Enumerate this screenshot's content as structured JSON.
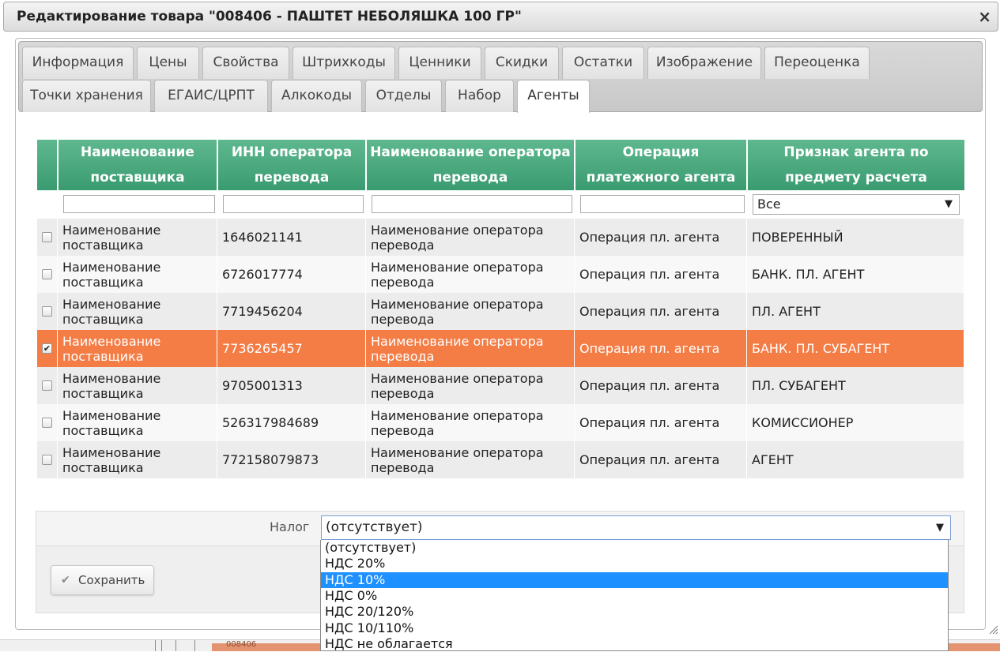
{
  "dialog": {
    "title": "Редактирование товара \"008406 - ПАШТЕТ НЕБОЛЯШКА 100 ГР\"",
    "close_label": "×"
  },
  "tabs": [
    {
      "label": "Информация"
    },
    {
      "label": "Цены"
    },
    {
      "label": "Свойства"
    },
    {
      "label": "Штрихкоды"
    },
    {
      "label": "Ценники"
    },
    {
      "label": "Скидки"
    },
    {
      "label": "Остатки"
    },
    {
      "label": "Изображение"
    },
    {
      "label": "Переоценка"
    },
    {
      "label": "Точки хранения"
    },
    {
      "label": "ЕГАИС/ЦРПТ"
    },
    {
      "label": "Алкокоды"
    },
    {
      "label": "Отделы"
    },
    {
      "label": "Набор"
    },
    {
      "label": "Агенты"
    }
  ],
  "active_tab": "Агенты",
  "grid": {
    "columns": [
      "Наименование поставщика",
      "ИНН оператора перевода",
      "Наименование оператора перевода",
      "Операция платежного агента",
      "Признак агента по предмету расчета"
    ],
    "filter_select_value": "Все",
    "rows": [
      {
        "checked": false,
        "supplier": "Наименование поставщика",
        "inn": "1646021141",
        "operator": "Наименование оператора перевода",
        "operation": "Операция пл. агента",
        "sign": "ПОВЕРЕННЫЙ"
      },
      {
        "checked": false,
        "supplier": "Наименование поставщика",
        "inn": "6726017774",
        "operator": "Наименование оператора перевода",
        "operation": "Операция пл. агента",
        "sign": "БАНК. ПЛ. АГЕНТ"
      },
      {
        "checked": false,
        "supplier": "Наименование поставщика",
        "inn": "7719456204",
        "operator": "Наименование оператора перевода",
        "operation": "Операция пл. агента",
        "sign": "ПЛ. АГЕНТ"
      },
      {
        "checked": true,
        "supplier": "Наименование поставщика",
        "inn": "7736265457",
        "operator": "Наименование оператора перевода",
        "operation": "Операция пл. агента",
        "sign": "БАНК. ПЛ. СУБАГЕНТ"
      },
      {
        "checked": false,
        "supplier": "Наименование поставщика",
        "inn": "9705001313",
        "operator": "Наименование оператора перевода",
        "operation": "Операция пл. агента",
        "sign": "ПЛ. СУБАГЕНТ"
      },
      {
        "checked": false,
        "supplier": "Наименование поставщика",
        "inn": "526317984689",
        "operator": "Наименование оператора перевода",
        "operation": "Операция пл. агента",
        "sign": "КОМИССИОНЕР"
      },
      {
        "checked": false,
        "supplier": "Наименование поставщика",
        "inn": "772158079873",
        "operator": "Наименование оператора перевода",
        "operation": "Операция пл. агента",
        "sign": "АГЕНТ"
      }
    ]
  },
  "tax": {
    "label": "Налог",
    "value": "(отсутствует)",
    "options": [
      "(отсутствует)",
      "НДС 20%",
      "НДС 10%",
      "НДС 0%",
      "НДС 20/120%",
      "НДС 10/110%",
      "НДС не облагается"
    ],
    "highlighted": "НДС 10%"
  },
  "save_label": "Сохранить",
  "background_row_text": "008406",
  "colors": {
    "header_green": "#3a9b70",
    "selected_row": "#f47c45",
    "row_odd": "#ececec",
    "row_even": "#f8f8f8",
    "dropdown_highlight": "#1e90ff"
  },
  "icons": {
    "close": "close-icon",
    "check": "checkmark-icon",
    "dropdown": "chevron-down-icon",
    "resize": "resize-grip-icon"
  }
}
